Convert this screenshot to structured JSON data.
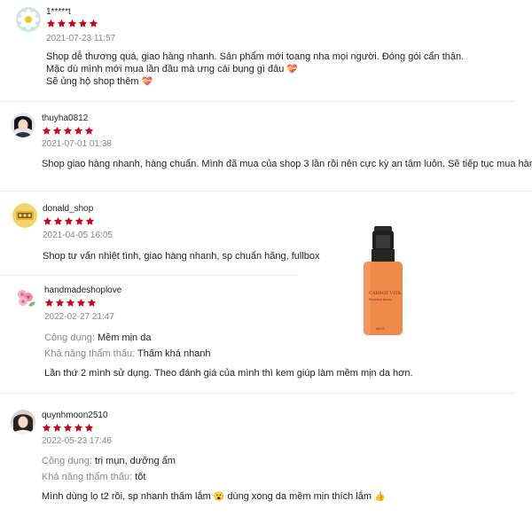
{
  "reviews": [
    {
      "username": "1*****t",
      "rating": 5,
      "date": "2021-07-23 11:57",
      "lines": [
        "Shop dễ thương quá, giao hàng nhanh. Sản phẩm mới toang nha mọi người. Đóng gói cẩn thận.",
        "Mặc dù mình mới mua lần đầu mà ưng cái bụng gì đâu",
        "Sẽ ủng hộ shop thêm"
      ],
      "emoji": "💝"
    },
    {
      "username": "thuyha0812",
      "rating": 5,
      "date": "2021-07-01 01:38",
      "lines": [
        "Shop giao hàng nhanh, hàng chuẩn. Mình đã mua của shop 3 lần rồi nên cực kỳ an tâm luôn. Sẽ tiếp tục mua hàng nè"
      ]
    },
    {
      "username": "donald_shop",
      "rating": 5,
      "date": "2021-04-05 16:05",
      "lines": [
        "Shop tư vấn nhiệt tình, giao hàng nhanh, sp chuẩn hãng, fullbox"
      ]
    },
    {
      "username": "handmadeshoplove",
      "rating": 5,
      "date": "2022-02-27 21:47",
      "attrs": [
        {
          "key": "Công dụng:",
          "value": "Mềm mịn da"
        },
        {
          "key": "Khả năng thẩm thấu:",
          "value": "Thấm khá nhanh"
        }
      ],
      "lines": [
        "Lần thứ 2 mình sử dụng. Theo đánh giá của mình thì kem giúp làm mềm mịn da hơn."
      ]
    },
    {
      "username": "quynhmoon2510",
      "rating": 5,
      "date": "2022-05-23 17:46",
      "attrs": [
        {
          "key": "Công dụng:",
          "value": "trị mụn, dưỡng ẩm"
        },
        {
          "key": "Khả năng thẩm thấu:",
          "value": "tốt"
        }
      ],
      "lines": [
        "Mình dùng lọ t2 rồi, sp nhanh thấm lắm",
        "dùng xong da mềm mịn thích lắm"
      ],
      "emojis": [
        "😮",
        "👍"
      ]
    }
  ],
  "product_label": {
    "brand": "CARROT VITA",
    "sub": "Recovery serum",
    "maker": "NAJIT"
  },
  "colors": {
    "star": "#d0011b",
    "bottle": "#f08a4b",
    "accent": "#222222"
  }
}
